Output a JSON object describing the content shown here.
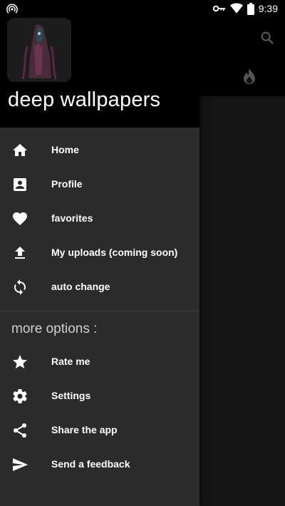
{
  "status_bar": {
    "time": "9:39"
  },
  "drawer": {
    "app_title": "deep wallpapers",
    "main_items": [
      {
        "label": "Home",
        "icon": "home-icon"
      },
      {
        "label": "Profile",
        "icon": "profile-icon"
      },
      {
        "label": "favorites",
        "icon": "heart-icon"
      },
      {
        "label": "My uploads (coming soon)",
        "icon": "upload-icon"
      },
      {
        "label": "auto change",
        "icon": "sync-icon"
      }
    ],
    "section_title": "more options :",
    "more_items": [
      {
        "label": "Rate me",
        "icon": "star-icon"
      },
      {
        "label": "Settings",
        "icon": "gear-icon"
      },
      {
        "label": "Share the app",
        "icon": "share-icon"
      },
      {
        "label": "Send a feedback",
        "icon": "send-icon"
      }
    ]
  },
  "colors": {
    "drawer_bg": "#2b2b2b",
    "header_bg": "#000000",
    "text": "#ffffff"
  }
}
